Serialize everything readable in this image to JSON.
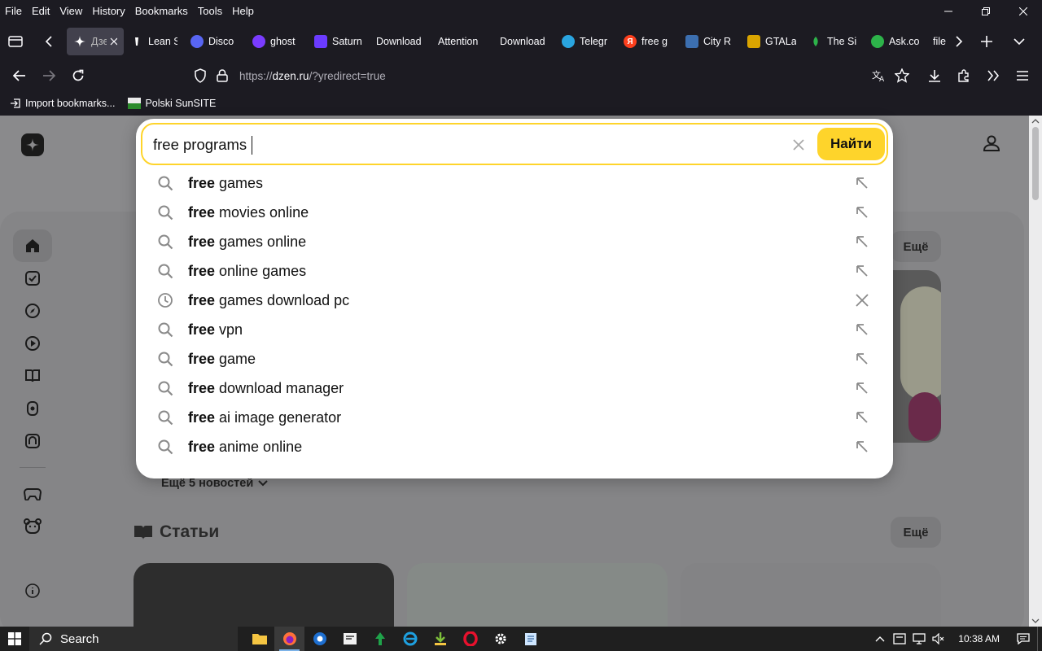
{
  "menubar": {
    "items": [
      "File",
      "Edit",
      "View",
      "History",
      "Bookmarks",
      "Tools",
      "Help"
    ]
  },
  "tabs": [
    {
      "label": "Дзе",
      "active": true,
      "fav_color": "#42414d"
    },
    {
      "label": "Lean S",
      "fav_color": "#5b5b66"
    },
    {
      "label": "Disco",
      "fav_color": "#5865f2"
    },
    {
      "label": "ghost",
      "fav_color": "#7a3cff"
    },
    {
      "label": "Saturn",
      "fav_color": "#6b3bff"
    },
    {
      "label": "Download",
      "fav_color": ""
    },
    {
      "label": "Attention",
      "fav_color": ""
    },
    {
      "label": "Download",
      "fav_color": ""
    },
    {
      "label": "Telegr",
      "fav_color": "#2aa5e0"
    },
    {
      "label": "free g",
      "fav_color": "#fc3f1d"
    },
    {
      "label": "City R",
      "fav_color": "#3c6fb0"
    },
    {
      "label": "GTALa",
      "fav_color": "#d9a400"
    },
    {
      "label": "The Si",
      "fav_color": "#2db34a"
    },
    {
      "label": "Ask.co",
      "fav_color": "#2db34a"
    },
    {
      "label": "file",
      "fav_color": ""
    }
  ],
  "url": {
    "scheme": "https://",
    "host": "dzen.ru",
    "path": "/?yredirect=true"
  },
  "bookmarks": [
    {
      "label": "Import bookmarks..."
    },
    {
      "label": "Polski SunSITE"
    }
  ],
  "search": {
    "query": "free programs",
    "button_label": "Найти",
    "suggestions": [
      {
        "bold": "free",
        "rest": " games",
        "type": "search",
        "action": "arrow"
      },
      {
        "bold": "free",
        "rest": " movies online",
        "type": "search",
        "action": "arrow"
      },
      {
        "bold": "free",
        "rest": " games online",
        "type": "search",
        "action": "arrow"
      },
      {
        "bold": "free",
        "rest": " online games",
        "type": "search",
        "action": "arrow"
      },
      {
        "bold": "free",
        "rest": " games download pc",
        "type": "history",
        "action": "remove"
      },
      {
        "bold": "free",
        "rest": " vpn",
        "type": "search",
        "action": "arrow"
      },
      {
        "bold": "free",
        "rest": " game",
        "type": "search",
        "action": "arrow"
      },
      {
        "bold": "free",
        "rest": " download manager",
        "type": "search",
        "action": "arrow"
      },
      {
        "bold": "free",
        "rest": " ai image generator",
        "type": "search",
        "action": "arrow"
      },
      {
        "bold": "free",
        "rest": " anime online",
        "type": "search",
        "action": "arrow"
      }
    ]
  },
  "page": {
    "more_label": "Ещё",
    "news_more": "Ещё 5 новостей",
    "articles_title": "Статьи",
    "articles_more": "Ещё"
  },
  "taskbar": {
    "search_label": "Search",
    "time": "10:38 AM"
  }
}
